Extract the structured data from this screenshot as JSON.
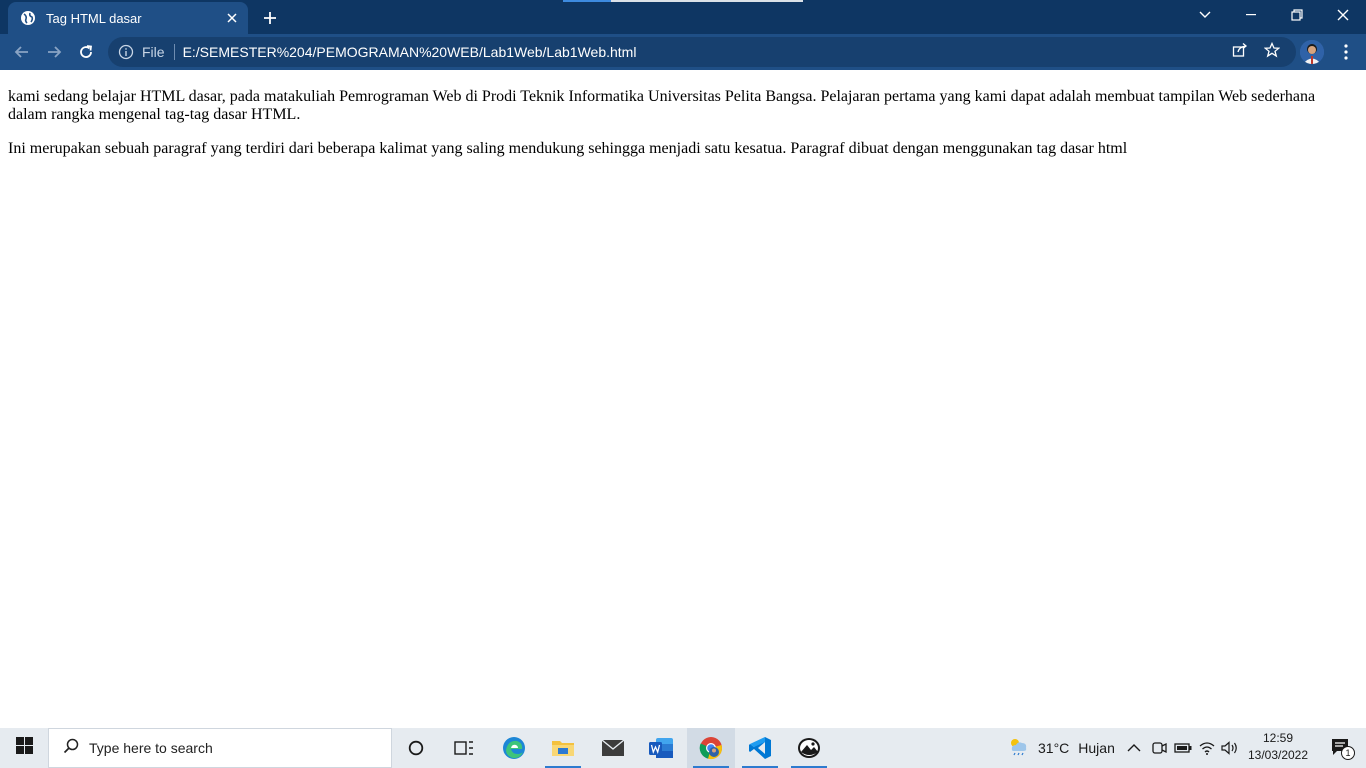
{
  "browser": {
    "tab_title": "Tag HTML dasar",
    "scheme_label": "File",
    "url": "E:/SEMESTER%204/PEMOGRAMAN%20WEB/Lab1Web/Lab1Web.html"
  },
  "page": {
    "paragraphs": [
      "kami sedang belajar HTML dasar, pada matakuliah Pemrograman Web di Prodi Teknik Informatika Universitas Pelita Bangsa. Pelajaran pertama yang kami dapat adalah membuat tampilan Web sederhana dalam rangka mengenal tag-tag dasar HTML.",
      "Ini merupakan sebuah paragraf yang terdiri dari beberapa kalimat yang saling mendukung sehingga menjadi satu kesatua. Paragraf dibuat dengan menggunakan tag dasar html"
    ]
  },
  "taskbar": {
    "search_placeholder": "Type here to search",
    "weather_temp": "31°C",
    "weather_desc": "Hujan",
    "time": "12:59",
    "date": "13/03/2022",
    "notification_count": "1",
    "pinned_apps": [
      "cortana-icon",
      "task-view-icon",
      "edge-icon",
      "file-explorer-icon",
      "mail-icon",
      "word-icon",
      "chrome-icon",
      "vscode-icon",
      "photos-icon"
    ]
  },
  "colors": {
    "titlebar": "#0e3663",
    "toolbar": "#1f4f86",
    "omnibox": "#17406f",
    "taskbar": "#e6ebf0",
    "accent": "#2e7bcf"
  }
}
